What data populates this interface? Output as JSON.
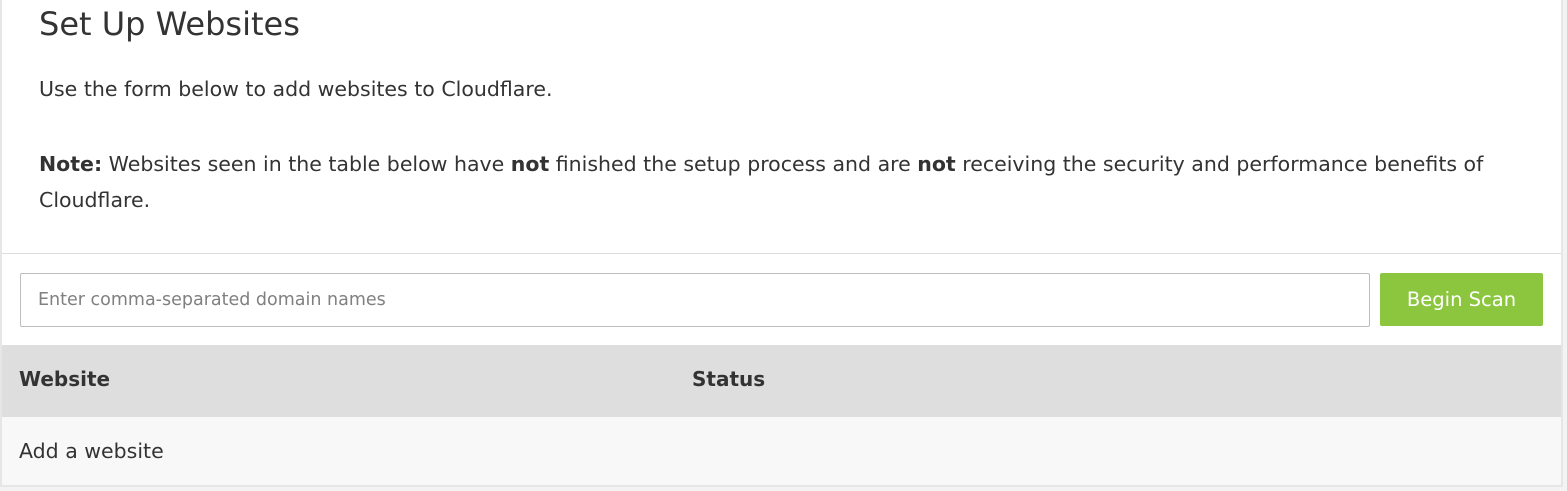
{
  "header": {
    "title": "Set Up Websites",
    "description": "Use the form below to add websites to Cloudflare."
  },
  "note": {
    "label": "Note:",
    "part1": " Websites seen in the table below have ",
    "emphasis1": "not",
    "part2": " finished the setup process and are ",
    "emphasis2": "not",
    "part3": " receiving the security and performance benefits of Cloudflare."
  },
  "form": {
    "input_value": "",
    "input_placeholder": "Enter comma-separated domain names",
    "scan_button_label": "Begin Scan"
  },
  "table": {
    "columns": [
      "Website",
      "Status"
    ],
    "rows": [
      {
        "website": "Add a website",
        "status": ""
      }
    ]
  },
  "colors": {
    "accent_button": "#8cc63f",
    "table_header_bg": "#dedede",
    "row_bg": "#f8f8f8",
    "text": "#333333"
  }
}
